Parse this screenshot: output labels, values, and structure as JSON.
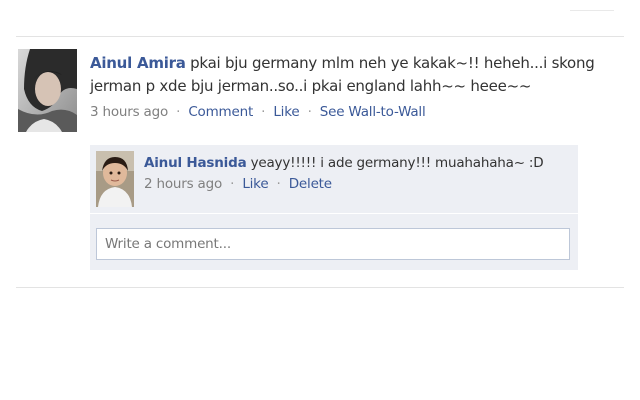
{
  "story": {
    "actor_name": "Ainul Amira",
    "message": "pkai bju germany mlm neh ye kakak~!! heheh...i skong jerman p xde bju jerman..so..i pkai england lahh~~ heee~~",
    "timestamp": "3 hours ago",
    "actions": {
      "comment": "Comment",
      "like": "Like",
      "wall_to_wall": "See Wall-to-Wall"
    }
  },
  "comment": {
    "author_name": "Ainul Hasnida",
    "message": "yeayy!!!!! i ade germany!!! muahahaha~ :D",
    "timestamp": "2 hours ago",
    "actions": {
      "like": "Like",
      "delete": "Delete"
    }
  },
  "composer": {
    "placeholder": "Write a comment..."
  },
  "colors": {
    "link": "#3b5998",
    "comment_background": "#edeff4",
    "input_border": "#bdc7d8"
  },
  "icons": {
    "separator": "middle-dot"
  }
}
